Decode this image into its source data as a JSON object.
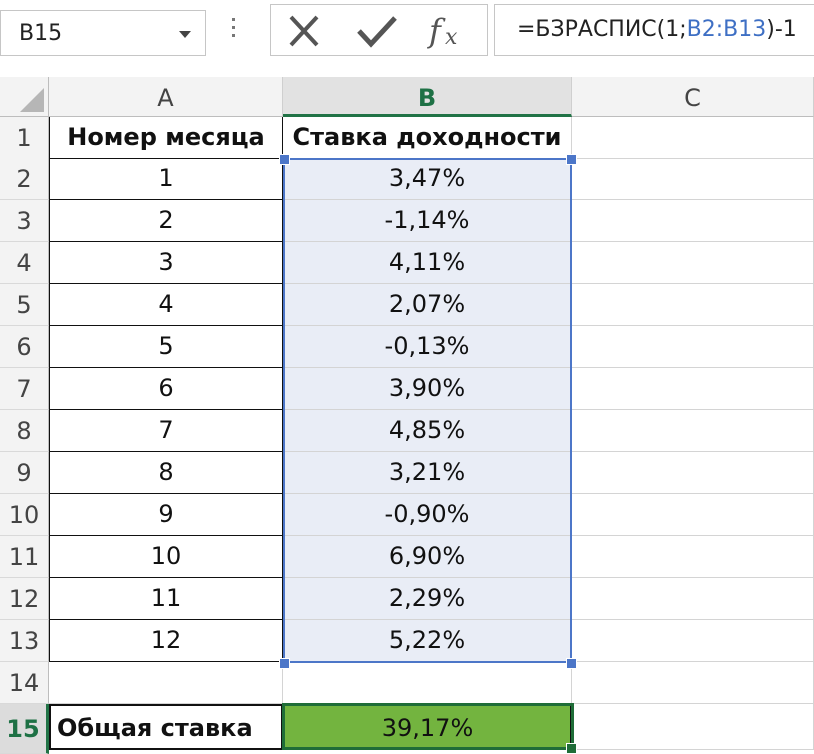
{
  "formula_bar": {
    "name_box": "B15",
    "formula_prefix": "=БЗРАСПИС(1;",
    "formula_ref": "B2:B13",
    "formula_suffix": ")-1"
  },
  "icons": {
    "cancel": "x-icon",
    "enter": "check-icon",
    "function": "fx-icon"
  },
  "columns": [
    "A",
    "B",
    "C"
  ],
  "rows": [
    "1",
    "2",
    "3",
    "4",
    "5",
    "6",
    "7",
    "8",
    "9",
    "10",
    "11",
    "12",
    "13",
    "14",
    "15"
  ],
  "headers": {
    "a": "Номер месяца",
    "b": "Ставка доходности"
  },
  "data": [
    {
      "month": "1",
      "rate": "3,47%"
    },
    {
      "month": "2",
      "rate": "-1,14%"
    },
    {
      "month": "3",
      "rate": "4,11%"
    },
    {
      "month": "4",
      "rate": "2,07%"
    },
    {
      "month": "5",
      "rate": "-0,13%"
    },
    {
      "month": "6",
      "rate": "3,90%"
    },
    {
      "month": "7",
      "rate": "4,85%"
    },
    {
      "month": "8",
      "rate": "3,21%"
    },
    {
      "month": "9",
      "rate": "-0,90%"
    },
    {
      "month": "10",
      "rate": "6,90%"
    },
    {
      "month": "11",
      "rate": "2,29%"
    },
    {
      "month": "12",
      "rate": "5,22%"
    }
  ],
  "total": {
    "label": "Общая ставка",
    "value": "39,17%"
  },
  "colors": {
    "selection": "#4c76c8",
    "active": "#1f6d38",
    "total_fill": "#73b43f",
    "range_fill": "#e9edf6"
  }
}
